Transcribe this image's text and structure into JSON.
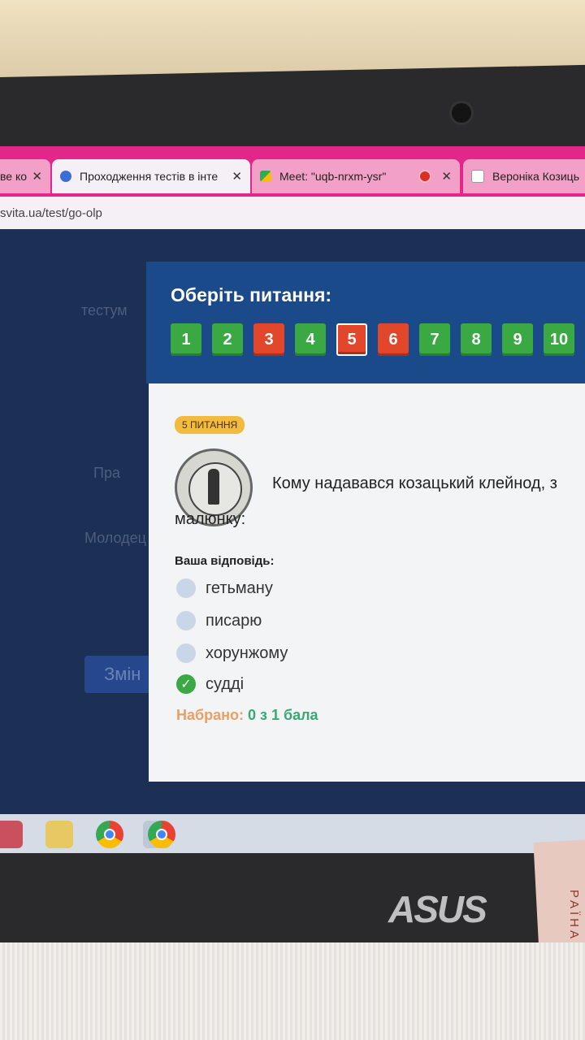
{
  "browser": {
    "tabs": [
      {
        "label": "ве ко",
        "color": "#f3a0c8"
      },
      {
        "label": "Проходження тестів в інтерак",
        "color": "#f4f0f6"
      },
      {
        "label": "Meet: \"uqb-nrxm-ysr\"",
        "color": "#f3a0c8"
      },
      {
        "label": "Вероніка Козиць",
        "color": "#f3a0c8"
      }
    ],
    "close_symbol": "✕",
    "url": "svita.ua/test/go-olp"
  },
  "background_page": {
    "text_1": "тестум",
    "text_2": "Пра",
    "text_3": "Молодец",
    "button": "Змін"
  },
  "modal": {
    "title": "Оберіть питання:",
    "questions": [
      {
        "label": "1",
        "status": "correct"
      },
      {
        "label": "2",
        "status": "correct"
      },
      {
        "label": "3",
        "status": "wrong"
      },
      {
        "label": "4",
        "status": "correct"
      },
      {
        "label": "5",
        "status": "wrong-current"
      },
      {
        "label": "6",
        "status": "wrong"
      },
      {
        "label": "7",
        "status": "correct"
      },
      {
        "label": "8",
        "status": "correct"
      },
      {
        "label": "9",
        "status": "correct"
      },
      {
        "label": "10",
        "status": "correct"
      }
    ],
    "badge": "5 ПИТАННЯ",
    "question_text_line1": "Кому надавався козацький клейнод, з",
    "question_text_line2": "малюнку:",
    "answer_label": "Ваша відповідь:",
    "options": [
      {
        "label": "гетьману",
        "selected": false
      },
      {
        "label": "писарю",
        "selected": false
      },
      {
        "label": "хорунжому",
        "selected": false
      },
      {
        "label": "судді",
        "selected": true
      }
    ],
    "score_label": "Набрано:",
    "score_value": "0 з 1 бала"
  },
  "taskbar": {
    "items": [
      "file-explorer-icon",
      "chrome-icon",
      "chrome-profile-icon"
    ]
  },
  "laptop": {
    "brand": "ASUS",
    "sticker_text": "РАЇНА"
  },
  "colors": {
    "correct": "#3aa843",
    "wrong": "#e2472b",
    "modal_header": "#1b4a8a",
    "badge": "#f2ba3e"
  }
}
